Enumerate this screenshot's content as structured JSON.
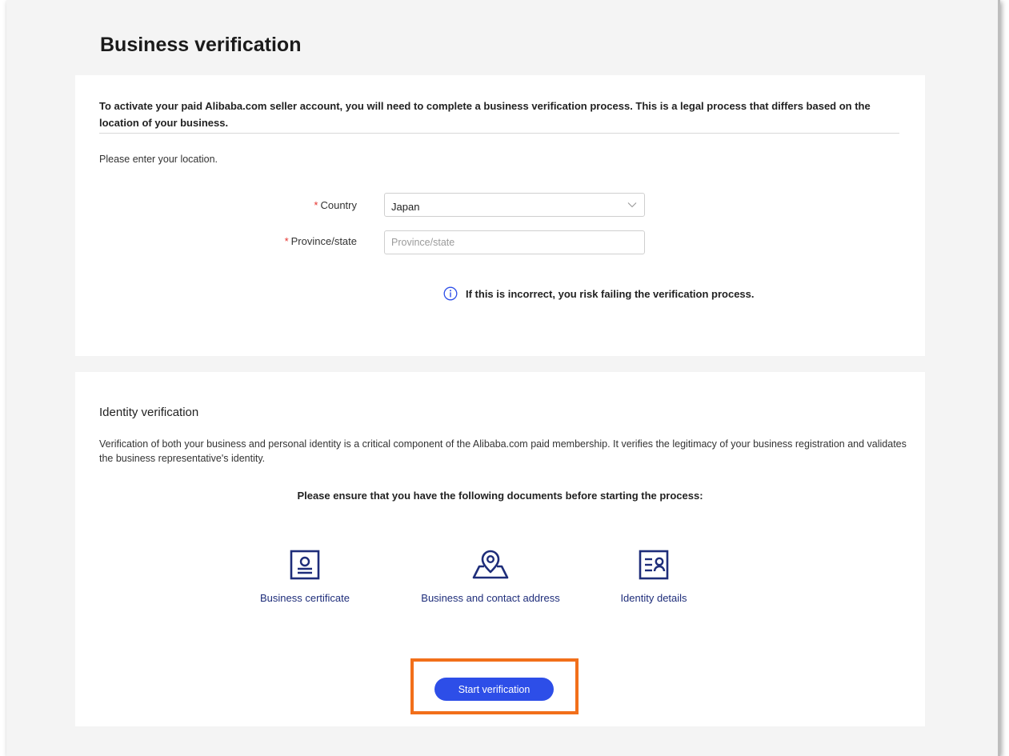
{
  "page": {
    "title": "Business verification"
  },
  "location_card": {
    "intro": "To activate your paid Alibaba.com seller account, you will need to complete a business verification process. This is a legal process that differs based on the location of your business.",
    "prompt": "Please enter your location.",
    "country": {
      "required_mark": "*",
      "label": "Country",
      "value": "Japan"
    },
    "province": {
      "required_mark": "*",
      "label": "Province/state",
      "value": "",
      "placeholder": "Province/state"
    },
    "warning": "If this is incorrect, you risk failing the verification process."
  },
  "identity_card": {
    "title": "Identity verification",
    "description": "Verification of both your business and personal identity is a critical component of the Alibaba.com paid membership. It verifies the legitimacy of your business registration and validates the business representative's identity.",
    "docs_prompt": "Please ensure that you have the following documents before starting the process:",
    "documents": [
      {
        "label": "Business certificate",
        "icon": "certificate-icon"
      },
      {
        "label": "Business and contact address",
        "icon": "location-pin-icon"
      },
      {
        "label": "Identity details",
        "icon": "id-card-icon"
      }
    ],
    "start_button": "Start verification"
  },
  "colors": {
    "accent": "#2d4ee8",
    "icon_navy": "#1e2d7a",
    "highlight": "#f26f1a",
    "required": "#e5322d",
    "info": "#2d4ee8"
  }
}
